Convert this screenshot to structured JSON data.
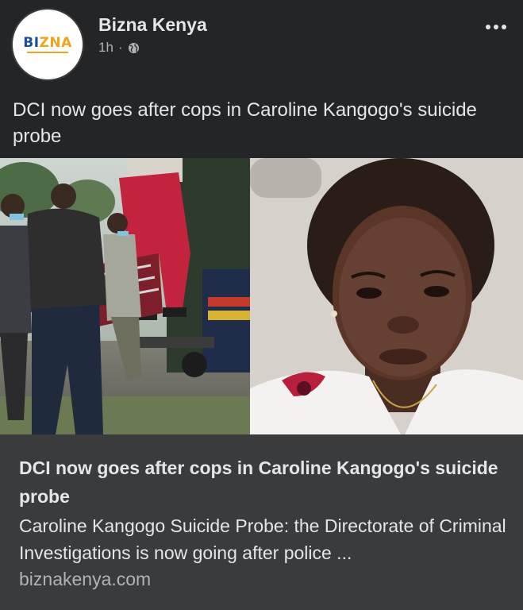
{
  "post": {
    "page_name": "Bizna Kenya",
    "timestamp": "1h",
    "separator": "·",
    "privacy_icon": "globe-icon",
    "more_icon": "more-options-icon",
    "text": "DCI now goes after cops in Caroline Kangogo's suicide probe"
  },
  "avatar": {
    "logo_text_prefix": "BI",
    "logo_text_suffix": "ZNA",
    "logo_colors": {
      "primary": "#1b4f9b",
      "accent": "#f2a31b"
    }
  },
  "link_preview": {
    "title": "DCI now goes after cops in Caroline Kangogo's suicide probe",
    "description": "Caroline Kangogo Suicide Probe: the Directorate of Criminal Investigations is now going after police ...",
    "domain": "biznakenya.com"
  },
  "colors": {
    "background": "#242526",
    "preview_background": "#3a3b3c",
    "primary_text": "#e4e6eb",
    "secondary_text": "#b0b3b8"
  }
}
